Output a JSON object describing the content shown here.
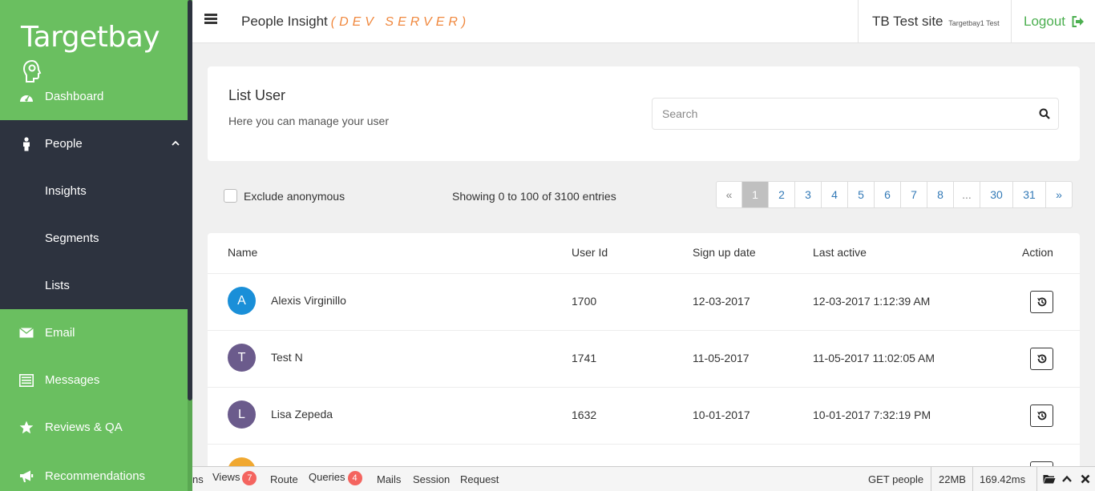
{
  "sidebar": {
    "logo": "Targetbay",
    "items": [
      {
        "label": "Dashboard",
        "icon": "dashboard-icon"
      },
      {
        "label": "People",
        "icon": "person-icon"
      },
      {
        "label": "Email",
        "icon": "envelope-icon"
      },
      {
        "label": "Messages",
        "icon": "messages-icon"
      },
      {
        "label": "Reviews & QA",
        "icon": "star-icon"
      },
      {
        "label": "Recommendations",
        "icon": "bullhorn-icon"
      }
    ],
    "sub_items": [
      {
        "label": "Insights"
      },
      {
        "label": "Segments"
      },
      {
        "label": "Lists"
      }
    ]
  },
  "topbar": {
    "title": "People Insight",
    "env": "(DEV SERVER)",
    "site_name": "TB Test site",
    "site_sub": "Targetbay1 Test",
    "logout": "Logout"
  },
  "header": {
    "title": "List User",
    "subtitle": "Here you can manage your user",
    "search_placeholder": "Search"
  },
  "filters": {
    "exclude_label": "Exclude anonymous",
    "showing": "Showing 0 to 100 of 3100 entries"
  },
  "pagination": [
    "«",
    "1",
    "2",
    "3",
    "4",
    "5",
    "6",
    "7",
    "8",
    "...",
    "30",
    "31",
    "»"
  ],
  "table": {
    "columns": [
      "Name",
      "User Id",
      "Sign up date",
      "Last active",
      "Action"
    ],
    "rows": [
      {
        "initial": "A",
        "color": "#1a8fd8",
        "name": "Alexis Virginillo",
        "user_id": "1700",
        "signup": "12-03-2017",
        "last_active": "12-03-2017 1:12:39 AM"
      },
      {
        "initial": "T",
        "color": "#6b5b8c",
        "name": "Test N",
        "user_id": "1741",
        "signup": "11-05-2017",
        "last_active": "11-05-2017 11:02:05 AM"
      },
      {
        "initial": "L",
        "color": "#6b5b8c",
        "name": "Lisa Zepeda",
        "user_id": "1632",
        "signup": "10-01-2017",
        "last_active": "10-01-2017 7:32:19 PM"
      },
      {
        "initial": "",
        "color": "#f0a830",
        "name": "",
        "user_id": "",
        "signup": "",
        "last_active": ""
      }
    ]
  },
  "debugbar": {
    "items": [
      "ns",
      "Views",
      "Route",
      "Queries",
      "Mails",
      "Session",
      "Request"
    ],
    "views_count": "7",
    "queries_count": "4",
    "route": "GET people",
    "memory": "22MB",
    "time": "169.42ms"
  },
  "colors": {
    "sidebar": "#6abf60",
    "sidebar_dark": "#2d333f",
    "accent_orange": "#f0883e",
    "link_blue": "#337ab7",
    "logout_green": "#4caf50"
  }
}
